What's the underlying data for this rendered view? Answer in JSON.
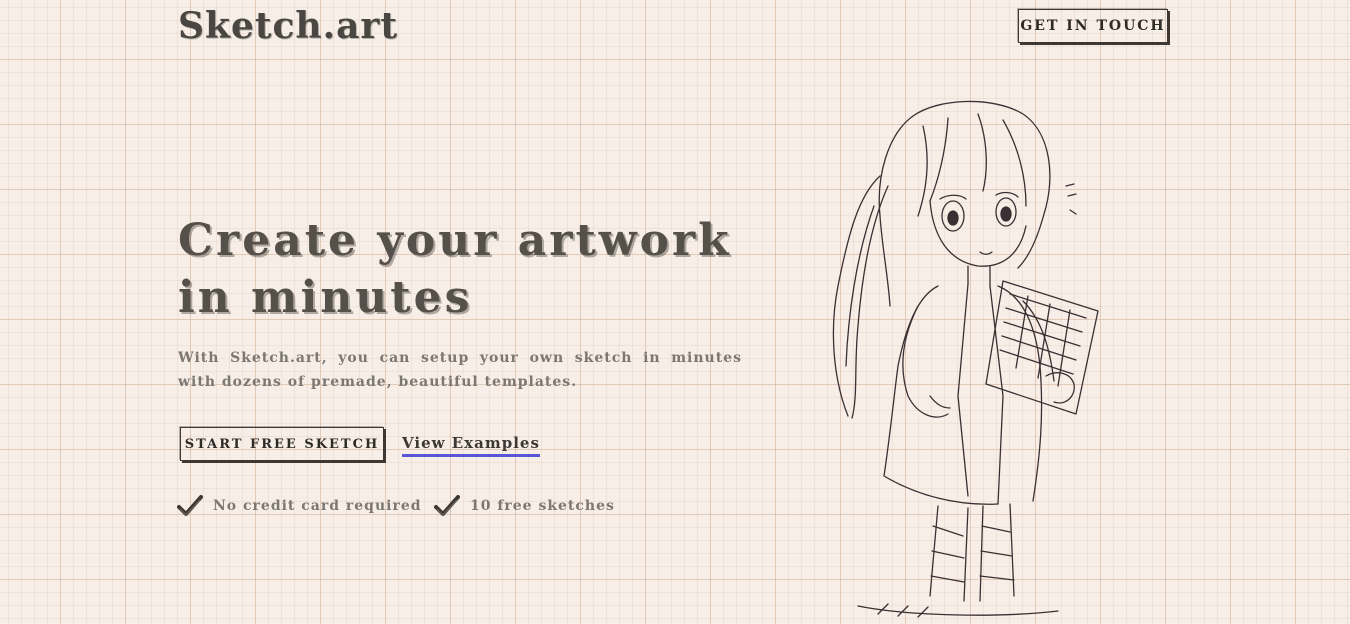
{
  "header": {
    "logo": "Sketch.art",
    "cta_label": "GET IN TOUCH"
  },
  "hero": {
    "title_line1": "Create your artwork",
    "title_line2": "in minutes",
    "subtitle": "With Sketch.art, you can setup your own sketch in minutes with dozens of premade, beautiful templates.",
    "primary_button": "START FREE SKETCH",
    "secondary_link": "View Examples",
    "features": [
      "No credit card required",
      "10 free sketches"
    ]
  },
  "colors": {
    "background": "#f7efe7",
    "grid": "#cdaf96",
    "ink": "#3d3833",
    "link_underline": "#5a57d6"
  }
}
